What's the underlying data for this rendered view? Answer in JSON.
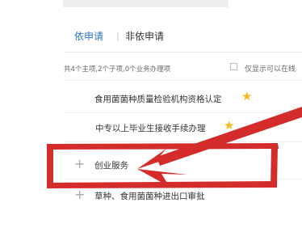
{
  "tabs": {
    "active": "依申请",
    "separator": "|",
    "other": "非依申请"
  },
  "summary": {
    "text": "共4个主项,2个子项,0个业务办理项",
    "filter_label": "仅显示可以在线"
  },
  "items": [
    {
      "label": "食用菌菌种质量检验机构资格认定",
      "starred": true
    },
    {
      "label": "中专以上毕业生接收手续办理",
      "starred": true
    },
    {
      "label": "创业服务",
      "starred": false
    },
    {
      "label": "草种、食用菌菌种进出口审批",
      "starred": false
    }
  ],
  "icons": {
    "expand": "plus-icon",
    "favorite": "star-icon",
    "checkbox": "checkbox-icon"
  },
  "colors": {
    "active_tab": "#2f78c4",
    "annotation": "#d42b2b",
    "star": "#f5b919"
  }
}
